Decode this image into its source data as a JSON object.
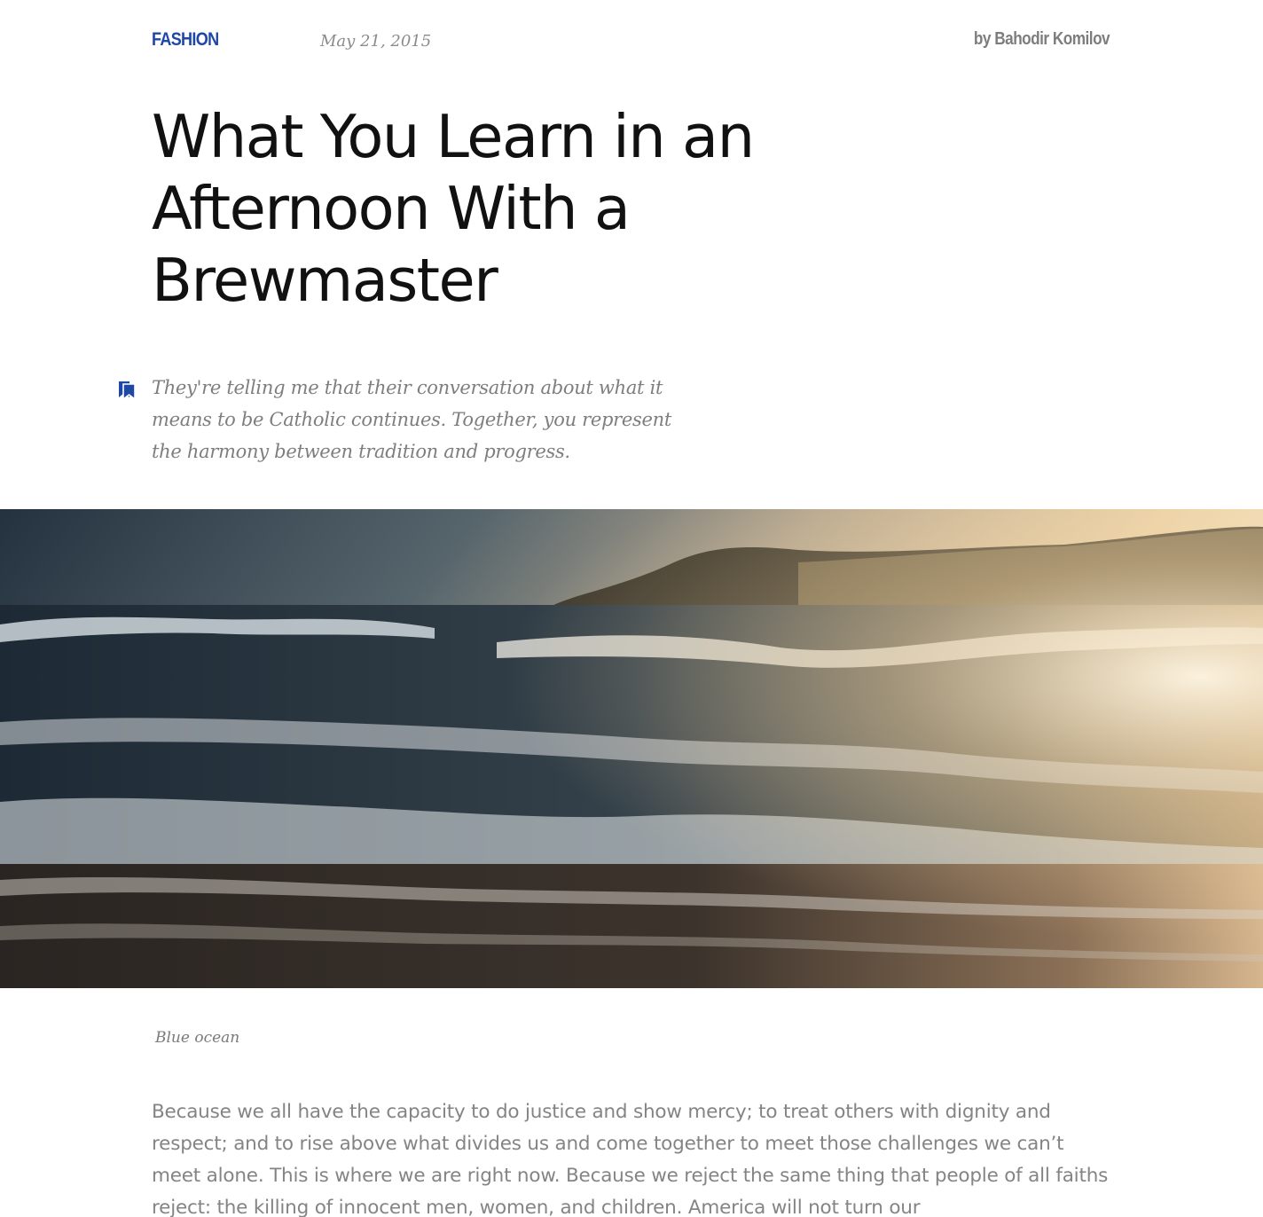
{
  "article": {
    "category": "FASHION",
    "date": "May 21, 2015",
    "author": "by Bahodir Komilov",
    "title": "What You Learn in an Afternoon With a Brewmaster",
    "lead_icon": "bookmarks-icon",
    "lead": "They're telling me that their conversation about what it means to be Catholic continues. Together, you represent the harmony between tradition and progress.",
    "image_caption": "Blue ocean",
    "body": "Because we all have the capacity to do justice and show mercy; to treat others with dignity and respect; and to rise above what divides us and come together to meet those challenges we can’t meet alone. This is where we are right now. Because we reject the same thing that people of all faiths reject: the killing of innocent men, women, and children. America will not turn our"
  },
  "colors": {
    "accent": "#1f47a5",
    "title": "#111111",
    "muted_text": "#7e7e7e",
    "background": "#ffffff"
  }
}
